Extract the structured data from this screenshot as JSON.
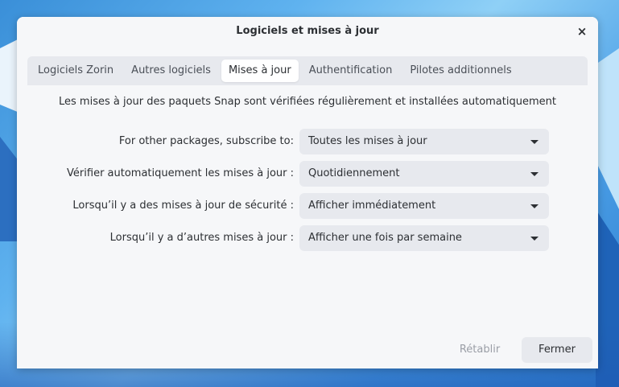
{
  "window": {
    "title": "Logiciels et mises à jour",
    "close_glyph": "×"
  },
  "tabs": [
    {
      "label": "Logiciels Zorin",
      "active": false
    },
    {
      "label": "Autres logiciels",
      "active": false
    },
    {
      "label": "Mises à jour",
      "active": true
    },
    {
      "label": "Authentification",
      "active": false
    },
    {
      "label": "Pilotes additionnels",
      "active": false
    }
  ],
  "updates": {
    "info_text": "Les mises à jour des paquets Snap sont vérifiées régulièrement et installées automatiquement",
    "rows": [
      {
        "label": "For other packages, subscribe to:",
        "value": "Toutes les mises à jour"
      },
      {
        "label": "Vérifier automatiquement les mises à jour :",
        "value": "Quotidiennement"
      },
      {
        "label": "Lorsqu’il y a des mises à jour de sécurité :",
        "value": "Afficher immédiatement"
      },
      {
        "label": "Lorsqu’il y a d’autres mises à jour :",
        "value": "Afficher une fois par semaine"
      }
    ]
  },
  "footer": {
    "reset_label": "Rétablir",
    "close_label": "Fermer"
  },
  "icons": {
    "close": "close-icon",
    "dropdown": "chevron-down-icon"
  },
  "colors": {
    "window_bg": "#f6f7f9",
    "control_bg": "#e7e9ee",
    "text": "#2c2f33",
    "disabled_text": "#9a9ea6"
  }
}
